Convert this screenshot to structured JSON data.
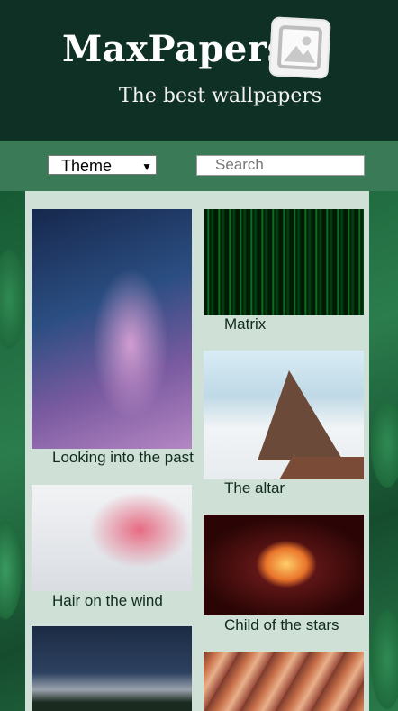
{
  "header": {
    "brand": "MaxPapers",
    "subtitle": "The best wallpapers"
  },
  "toolbar": {
    "theme_select": {
      "value": "Theme"
    },
    "search": {
      "placeholder": "Search"
    }
  },
  "gallery": [
    {
      "caption": "Looking into the past"
    },
    {
      "caption": "Matrix"
    },
    {
      "caption": "The altar"
    },
    {
      "caption": "Hair on the wind"
    },
    {
      "caption": "Child of the stars"
    },
    {
      "caption": ""
    },
    {
      "caption": ""
    }
  ],
  "icons": {
    "logo": "image-icon",
    "select_arrow": "chevron-down-icon"
  },
  "colors": {
    "header_bg": "#0f3024",
    "toolbar_bg": "#3a7a57",
    "content_bg": "#cfe0d6",
    "caption_text": "#102b20"
  }
}
